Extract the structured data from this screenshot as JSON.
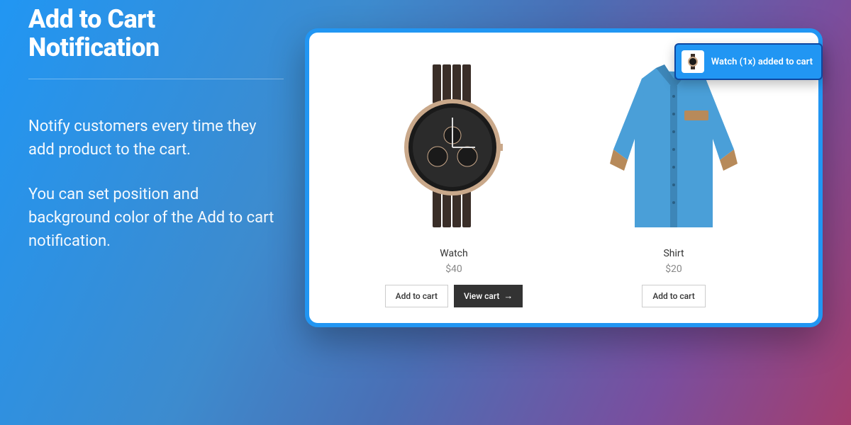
{
  "header": {
    "title_line1": "Add to Cart",
    "title_line2": "Notification"
  },
  "content": {
    "para1": "Notify customers every time they add product to the cart.",
    "para2": "You can set position and background color of the Add to cart notification."
  },
  "panel": {
    "products": [
      {
        "name": "Watch",
        "price": "$40",
        "add_label": "Add to cart",
        "view_label": "View cart",
        "show_view": true
      },
      {
        "name": "Shirt",
        "price": "$20",
        "add_label": "Add to cart",
        "show_view": false
      }
    ]
  },
  "toast": {
    "message": "Watch (1x) added to cart"
  }
}
